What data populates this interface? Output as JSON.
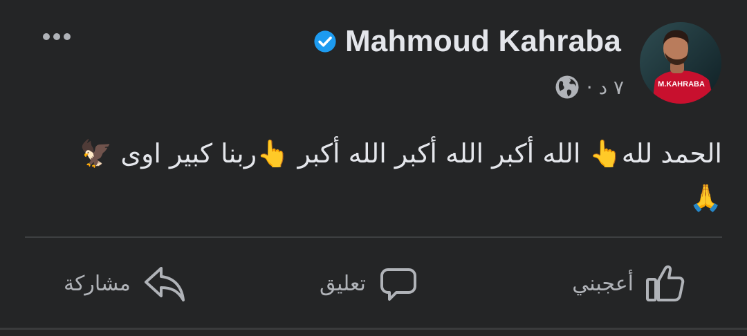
{
  "post": {
    "author": {
      "name": "Mahmoud Kahraba",
      "verified": true,
      "avatar_icon": "avatar-photo",
      "jersey_text": "M.KAHRABA"
    },
    "meta": {
      "time": "٧ د ·",
      "audience_icon": "globe-icon"
    },
    "more_icon": "ellipsis-icon",
    "text_lines": [
      "الحمد لله👆 الله أكبر الله أكبر الله أكبر 👆ربنا كبير اوى 🦅",
      "🙏"
    ],
    "actions": {
      "like_label": "أعجبني",
      "comment_label": "تعليق",
      "share_label": "مشاركة"
    }
  },
  "colors": {
    "background": "#242526",
    "text_primary": "#e4e6eb",
    "text_secondary": "#b0b3b8",
    "verified_blue": "#1d9bf0",
    "divider": "#3e4042",
    "jersey_red": "#c8102e"
  }
}
